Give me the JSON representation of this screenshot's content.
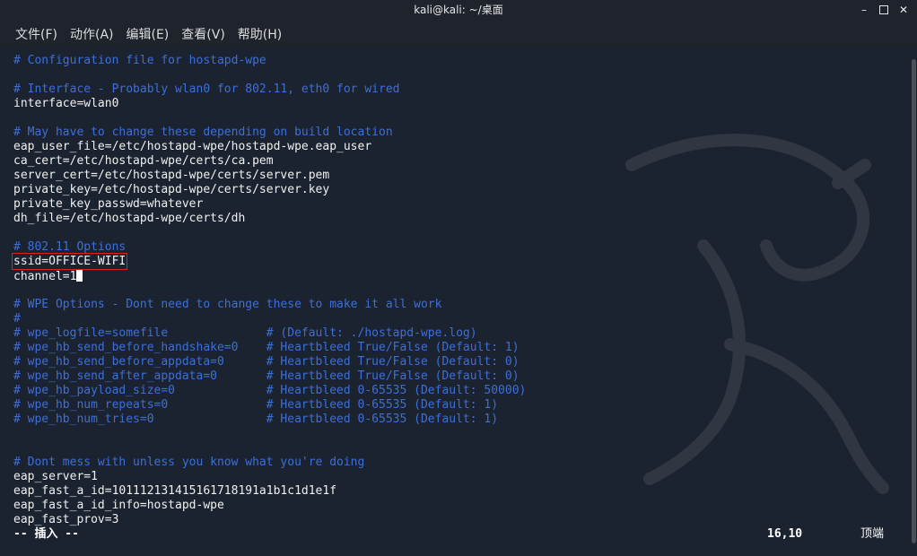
{
  "window": {
    "title": "kali@kali: ~/桌面"
  },
  "menu": [
    {
      "label": "文件(F)"
    },
    {
      "label": "动作(A)"
    },
    {
      "label": "编辑(E)"
    },
    {
      "label": "查看(V)"
    },
    {
      "label": "帮助(H)"
    }
  ],
  "editor": {
    "lines": [
      {
        "text": "# Configuration file for hostapd-wpe",
        "style": "comment"
      },
      {
        "text": "",
        "style": "plain"
      },
      {
        "text": "# Interface - Probably wlan0 for 802.11, eth0 for wired",
        "style": "comment"
      },
      {
        "text": "interface=wlan0",
        "style": "plain"
      },
      {
        "text": "",
        "style": "plain"
      },
      {
        "text": "# May have to change these depending on build location",
        "style": "comment"
      },
      {
        "text": "eap_user_file=/etc/hostapd-wpe/hostapd-wpe.eap_user",
        "style": "plain"
      },
      {
        "text": "ca_cert=/etc/hostapd-wpe/certs/ca.pem",
        "style": "plain"
      },
      {
        "text": "server_cert=/etc/hostapd-wpe/certs/server.pem",
        "style": "plain"
      },
      {
        "text": "private_key=/etc/hostapd-wpe/certs/server.key",
        "style": "plain"
      },
      {
        "text": "private_key_passwd=whatever",
        "style": "plain"
      },
      {
        "text": "dh_file=/etc/hostapd-wpe/certs/dh",
        "style": "plain"
      },
      {
        "text": "",
        "style": "plain"
      },
      {
        "text": "# 802.11 Options",
        "style": "comment"
      },
      {
        "text": "ssid=OFFICE-WIFI",
        "style": "plain"
      },
      {
        "text": "channel=1",
        "style": "plain"
      },
      {
        "text": "",
        "style": "plain"
      },
      {
        "text": "# WPE Options - Dont need to change these to make it all work",
        "style": "comment"
      },
      {
        "text": "#",
        "style": "comment"
      },
      {
        "text": "# wpe_logfile=somefile              # (Default: ./hostapd-wpe.log)",
        "style": "comment"
      },
      {
        "text": "# wpe_hb_send_before_handshake=0    # Heartbleed True/False (Default: 1)",
        "style": "comment"
      },
      {
        "text": "# wpe_hb_send_before_appdata=0      # Heartbleed True/False (Default: 0)",
        "style": "comment"
      },
      {
        "text": "# wpe_hb_send_after_appdata=0       # Heartbleed True/False (Default: 0)",
        "style": "comment"
      },
      {
        "text": "# wpe_hb_payload_size=0             # Heartbleed 0-65535 (Default: 50000)",
        "style": "comment"
      },
      {
        "text": "# wpe_hb_num_repeats=0              # Heartbleed 0-65535 (Default: 1)",
        "style": "comment"
      },
      {
        "text": "# wpe_hb_num_tries=0                # Heartbleed 0-65535 (Default: 1)",
        "style": "comment"
      },
      {
        "text": "",
        "style": "plain"
      },
      {
        "text": "",
        "style": "plain"
      },
      {
        "text": "# Dont mess with unless you know what you're doing",
        "style": "comment"
      },
      {
        "text": "eap_server=1",
        "style": "plain"
      },
      {
        "text": "eap_fast_a_id=101112131415161718191a1b1c1d1e1f",
        "style": "plain"
      },
      {
        "text": "eap_fast_a_id_info=hostapd-wpe",
        "style": "plain"
      },
      {
        "text": "eap_fast_prov=3",
        "style": "plain"
      }
    ]
  },
  "status": {
    "mode": "-- 插入 --",
    "position": "16,10",
    "scroll": "顶端"
  },
  "colors": {
    "comment": "#3d6fd6",
    "text": "#f0f0f0",
    "highlight_box": "#e02020",
    "background": "#1b2330"
  },
  "icons": {
    "minimize": "minimize-icon",
    "maximize": "maximize-icon",
    "close": "close-icon"
  }
}
